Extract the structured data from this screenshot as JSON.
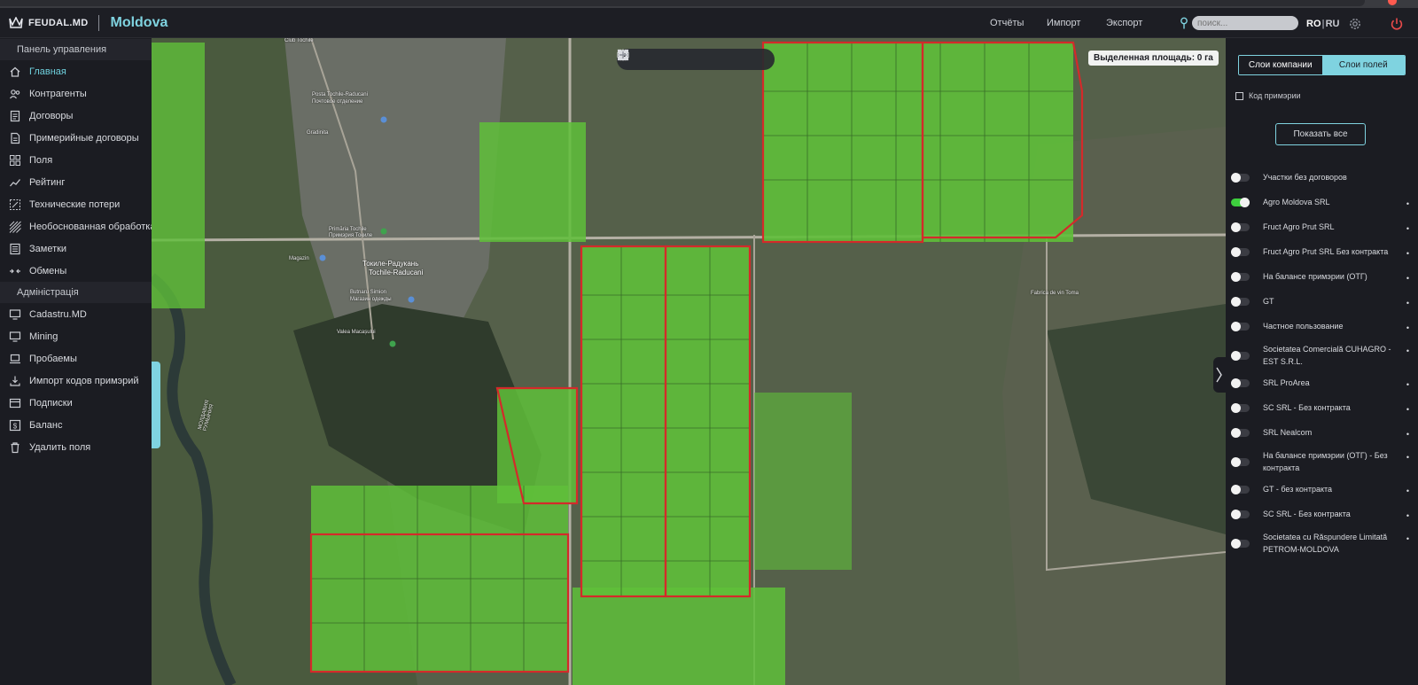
{
  "header": {
    "logo_text": "FEUDAL.MD",
    "country": "Moldova",
    "nav": [
      "Отчёты",
      "Импорт",
      "Экспорт"
    ],
    "search_placeholder": "поиск...",
    "lang_active": "RO",
    "lang_other": "RU"
  },
  "sidebar": {
    "section_panel": "Панель управления",
    "items": [
      {
        "label": "Главная",
        "icon": "home-icon"
      },
      {
        "label": "Контрагенты",
        "icon": "contractors-icon"
      },
      {
        "label": "Договоры",
        "icon": "contracts-icon"
      },
      {
        "label": "Примерийные договоры",
        "icon": "document-icon"
      },
      {
        "label": "Поля",
        "icon": "fields-icon"
      },
      {
        "label": "Рейтинг",
        "icon": "chart-icon"
      },
      {
        "label": "Технические потери",
        "icon": "loss-icon"
      },
      {
        "label": "Необоснованная обработка",
        "icon": "hatch-icon"
      },
      {
        "label": "Заметки",
        "icon": "notes-icon"
      },
      {
        "label": "Обмены",
        "icon": "exchange-icon"
      }
    ],
    "section_admin": "Адміністрація",
    "admin_items": [
      {
        "label": "Cadastru.MD",
        "icon": "monitor-icon"
      },
      {
        "label": "Mining",
        "icon": "monitor-icon"
      },
      {
        "label": "Пробаемы",
        "icon": "laptop-icon"
      },
      {
        "label": "Импорт кодов примэрий",
        "icon": "import-icon"
      },
      {
        "label": "Подписки",
        "icon": "subscription-icon"
      },
      {
        "label": "Баланс",
        "icon": "balance-icon"
      },
      {
        "label": "Удалить поля",
        "icon": "trash-icon"
      }
    ]
  },
  "map": {
    "selected_area": "Выделенная площадь: 0 га",
    "labels": {
      "club": "Club Tochile",
      "posta": "Posta Tochile-Raducani",
      "posta_sub": "Почтовое отделение",
      "gradinita": "Gradinita",
      "primaria": "Primăria Tochile",
      "primaria_sub": "Примэрия Токиле",
      "magazin": "Magazin",
      "town": "Токиле-Радукань",
      "town_ro": "Tochile-Raducani",
      "butnaru": "Butnaru Simion",
      "butnaru_sub": "Магазин одежды",
      "valea": "Valea Macașului",
      "fabrica": "Fabrica de vin Toma",
      "river": "МОЛДАВИЯ\nРУМЫНИЯ"
    }
  },
  "right_panel": {
    "tab_company": "Слои компании",
    "tab_fields": "Слои полей",
    "checkbox_label": "Код примэрии",
    "show_all": "Показать все",
    "layers": [
      {
        "label": "Участки без договоров",
        "on": false
      },
      {
        "label": "Agro Moldova SRL",
        "on": true
      },
      {
        "label": "Fruct Agro Prut SRL",
        "on": false
      },
      {
        "label": "Fruct Agro Prut SRL Без контракта",
        "on": false
      },
      {
        "label": "На балансе примэрии (ОТГ)",
        "on": false
      },
      {
        "label": "GT",
        "on": false
      },
      {
        "label": "Частное пользование",
        "on": false
      },
      {
        "label": "Societatea Comercială CUHAGRO - EST S.R.L.",
        "on": false
      },
      {
        "label": "SRL ProArea",
        "on": false
      },
      {
        "label": "SC SRL - Без контракта",
        "on": false
      },
      {
        "label": "SRL Nealcom",
        "on": false
      },
      {
        "label": "На балансе примэрии (ОТГ) - Без контракта",
        "on": false
      },
      {
        "label": "GT - без контракта",
        "on": false
      },
      {
        "label": "SC SRL - Без контракта",
        "on": false
      },
      {
        "label": "Societatea cu Răspundere Limitată PETROM-MOLDOVA",
        "on": false
      }
    ]
  }
}
